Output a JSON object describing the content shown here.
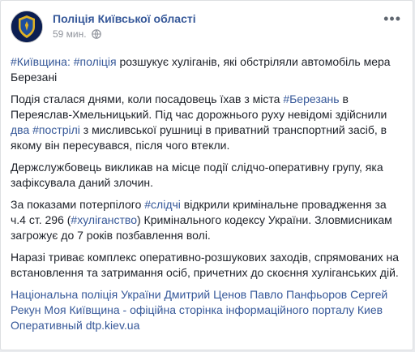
{
  "post": {
    "page_name": "Поліція Київської області",
    "time": "59 мин.",
    "audience_icon": "globe-icon",
    "more_icon": "more-options-icon",
    "title": {
      "tag1": "#Київщина:",
      "tag2": "#поліція",
      "text": " розшукує хуліганів, які обстріляли автомобіль мера Березані"
    },
    "p1": {
      "a": "Подія сталася днями, коли посадовець їхав з міста ",
      "tag_berezan": "#Березань",
      "b": " в Переяслав-Хмельницький. Під час дорожнього руху невідомі здійснили ",
      "num": "два",
      "c": " ",
      "tag_postrily": "#пострілі",
      "d": " з мисливської рушниці в приватний транспортний засіб, в якому він пересувався, після чого втекли."
    },
    "p2": "Держслужбовець викликав на місце події слідчо-оперативну групу, яка зафіксувала даний злочин.",
    "p3": {
      "a": "За показами потерпілого ",
      "tag_slidchi": "#слідчі",
      "b": " відкрили кримінальне провадження за ч.4 ст. 296 (",
      "tag_khuligan": "#хуліганство",
      "c": ") Кримінального кодексу України. Зловмисникам загрожує до 7 років позбавлення волі."
    },
    "p4": "Наразі триває комплекс оперативно-розшукових заходів, спрямованих на встановлення та затримання осіб, причетних до скоєння хуліганських дій.",
    "mentions": {
      "m1": "Національна поліція України",
      "m2": "Дмитрий Ценов",
      "m3": "Павло Панфьоров",
      "m4": "Сергей Рекун",
      "m5": "Моя Київщина - офіційна сторінка інформаційного порталу Киев Оперативный",
      "m6": "dtp.kiev.ua"
    }
  },
  "colors": {
    "link": "#365899",
    "text": "#1d2129",
    "meta": "#90949c",
    "avatar_bg": "#0b1e52",
    "badge_gold": "#e0b224"
  }
}
